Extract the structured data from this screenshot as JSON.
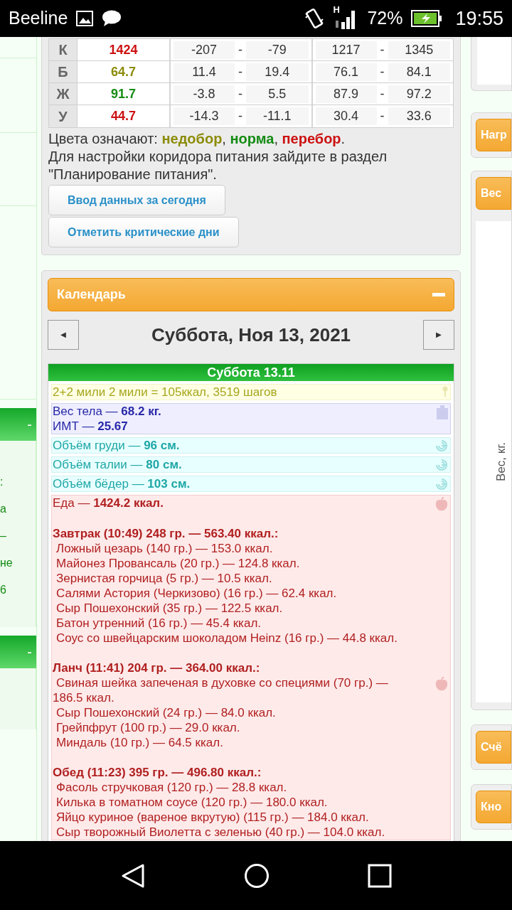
{
  "status_bar": {
    "carrier": "Beeline",
    "network_type": "H",
    "battery": "72%",
    "time": "19:55"
  },
  "left_panel": {
    "sections": [
      {
        "toggle": "-",
        "lines": [
          ":",
          "а",
          "–",
          "не",
          "6"
        ]
      },
      {
        "toggle": "-"
      }
    ]
  },
  "nutrition_table": {
    "rows": [
      {
        "label": "К",
        "value": "1424",
        "color": "#cc1111",
        "range1": [
          "-207",
          "-79"
        ],
        "range2": [
          "1217",
          "1345"
        ]
      },
      {
        "label": "Б",
        "value": "64.7",
        "color": "#8c8c0a",
        "range1": [
          "11.4",
          "19.4"
        ],
        "range2": [
          "76.1",
          "84.1"
        ]
      },
      {
        "label": "Ж",
        "value": "91.7",
        "color": "#148c14",
        "range1": [
          "-3.8",
          "5.5"
        ],
        "range2": [
          "87.9",
          "97.2"
        ]
      },
      {
        "label": "У",
        "value": "44.7",
        "color": "#cc1111",
        "range1": [
          "-14.3",
          "-11.1"
        ],
        "range2": [
          "30.4",
          "33.6"
        ]
      }
    ],
    "separator": "-"
  },
  "legend": [
    {
      "text": "Цвета означают: "
    },
    {
      "text": "недобор",
      "color": "#8c8c0a"
    },
    {
      "text": ", "
    },
    {
      "text": "норма",
      "color": "#148c14"
    },
    {
      "text": ", "
    },
    {
      "text": "перебор",
      "color": "#cc1111"
    },
    {
      "text": "."
    }
  ],
  "hint": "Для настройки коридора питания зайдите в раздел \"Планирование питания\".",
  "buttons": [
    "Ввод данных за сегодня",
    "Отметить критические дни"
  ],
  "calendar": {
    "title": "Календарь",
    "prev": "◄",
    "next": "►",
    "date": "Суббота, Ноя 13, 2021",
    "day_title": "Суббота 13.11",
    "entries": [
      {
        "kind": "note",
        "lines": [
          "2+2 мили 2 мили = 105ккал, 3519 шагов"
        ]
      },
      {
        "kind": "weight",
        "lines": [
          "Вес тела — **68.2 кг.**",
          "ИМТ — **25.67**"
        ]
      },
      {
        "kind": "measure",
        "lines": [
          "Объём груди — **96 см.**"
        ]
      },
      {
        "kind": "measure",
        "lines": [
          "Объём талии — **80 см.**"
        ]
      },
      {
        "kind": "measure",
        "lines": [
          "Объём бёдер — **103 см.**"
        ]
      },
      {
        "kind": "food",
        "lines": [
          "Еда — **1424.2 ккал.**"
        ],
        "meals": [
          {
            "title": "Завтрак (10:49) 248 гр. — 563.40 ккал.:",
            "icon": false,
            "items": [
              "Ложный цезарь (140 гр.) — 153.0 ккал.",
              "Майонез Провансаль (20 гр.) — 124.8 ккал.",
              "Зернистая горчица (5 гр.) — 10.5 ккал.",
              "Салями Астория (Черкизово) (16 гр.) — 62.4 ккал.",
              "Сыр Пошехонский (35 гр.) — 122.5 ккал.",
              "Батон утренний (16 гр.) — 45.4 ккал.",
              "Соус со швейцарским шоколадом Heinz (16 гр.) — 44.8 ккал."
            ]
          },
          {
            "title": "Ланч (11:41) 204 гр. — 364.00 ккал.:",
            "icon": true,
            "items": [
              "Свиная шейка запеченая в духовке со специями (70 гр.) — 186.5 ккал.",
              "Сыр Пошехонский (24 гр.) — 84.0 ккал.",
              "Грейпфрут (100 гр.) — 29.0 ккал.",
              "Миндаль (10 гр.) — 64.5 ккал."
            ]
          },
          {
            "title": "Обед (11:23) 395 гр. — 496.80 ккал.:",
            "icon": false,
            "items": [
              "Фасоль стручковая (120 гр.) — 28.8 ккал.",
              "Килька в томатном соусе (120 гр.) — 180.0 ккал.",
              "Яйцо куриное (вареное вкрутую) (115 гр.) — 184.0 ккал.",
              "Сыр творожный Виолетта с зеленью (40 гр.) — 104.0 ккал."
            ]
          }
        ]
      }
    ]
  },
  "right_panel": {
    "buttons": [
      "Нагр",
      "Вес"
    ],
    "chart_axis_label": "Вес, кг.",
    "more_buttons": [
      "Счё",
      "Кно"
    ]
  }
}
